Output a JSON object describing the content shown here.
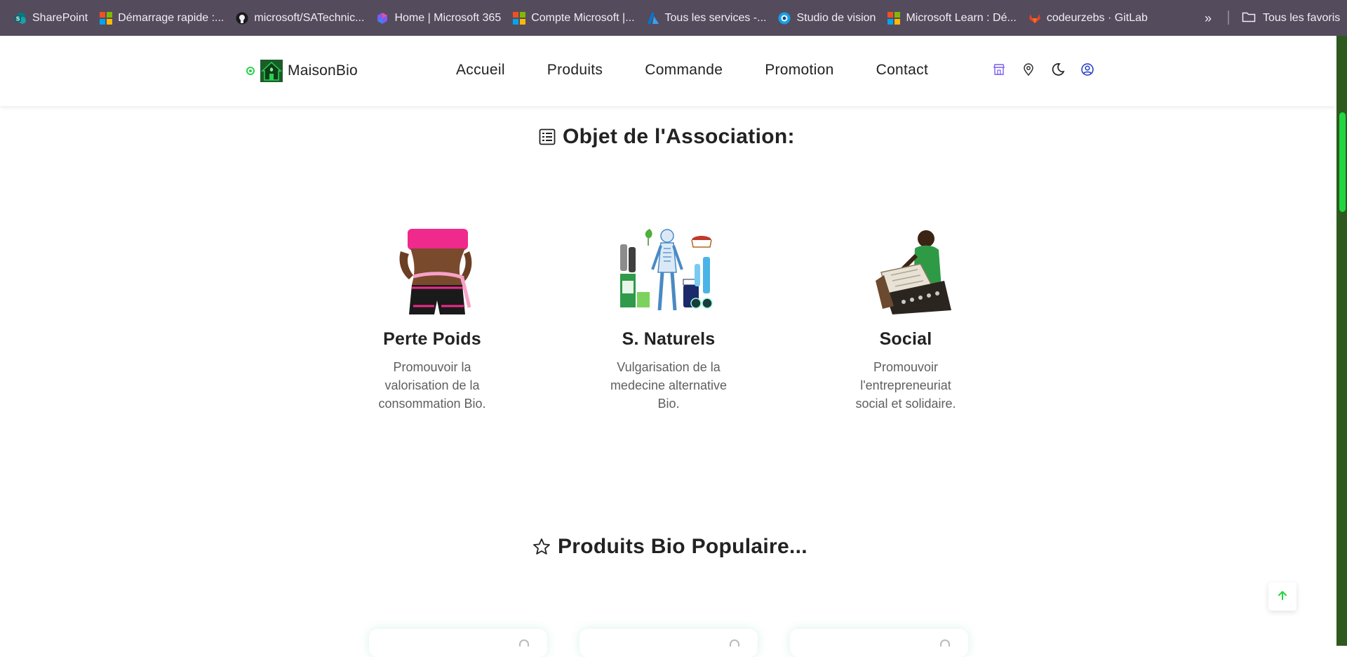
{
  "bookmarks": [
    {
      "label": "SharePoint",
      "icon": "sharepoint-icon"
    },
    {
      "label": "Démarrage rapide :...",
      "icon": "microsoft-logo-icon"
    },
    {
      "label": "microsoft/SATechnic...",
      "icon": "github-icon"
    },
    {
      "label": "Home | Microsoft 365",
      "icon": "microsoft365-icon"
    },
    {
      "label": "Compte Microsoft |...",
      "icon": "microsoft-logo-icon"
    },
    {
      "label": "Tous les services -...",
      "icon": "azure-icon"
    },
    {
      "label": "Studio de vision",
      "icon": "vision-studio-icon"
    },
    {
      "label": "Microsoft Learn : Dé...",
      "icon": "microsoft-logo-icon"
    },
    {
      "label": "codeurzebs · GitLab",
      "icon": "gitlab-icon"
    }
  ],
  "bookmarks_more_icon": "chevrons-right-icon",
  "all_favorites": {
    "label": "Tous les favoris",
    "icon": "folder-icon"
  },
  "navbar": {
    "brand": "MaisonBio",
    "links": [
      "Accueil",
      "Produits",
      "Commande",
      "Promotion",
      "Contact"
    ],
    "icons": [
      "store-icon",
      "location-pin-icon",
      "moon-icon",
      "user-circle-icon"
    ]
  },
  "association": {
    "title": "Objet de l'Association:",
    "icon": "list-icon",
    "features": [
      {
        "title": "Perte Poids",
        "text": "Promouvoir la valorisation de la consommation Bio.",
        "image": "weight-loss-image"
      },
      {
        "title": "S. Naturels",
        "text": "Vulgarisation de la medecine alternative Bio.",
        "image": "natural-health-image"
      },
      {
        "title": "Social",
        "text": "Promouvoir l'entrepreneuriat social et solidaire.",
        "image": "social-entrepreneur-image"
      }
    ]
  },
  "popular": {
    "title": "Produits Bio Populaire...",
    "icon": "star-icon"
  },
  "colors": {
    "bookmarks_bg": "#544b5c",
    "accent_green": "#22d63f",
    "scroll_track": "#2e5a1f"
  },
  "back_to_top_icon": "arrow-up-icon"
}
